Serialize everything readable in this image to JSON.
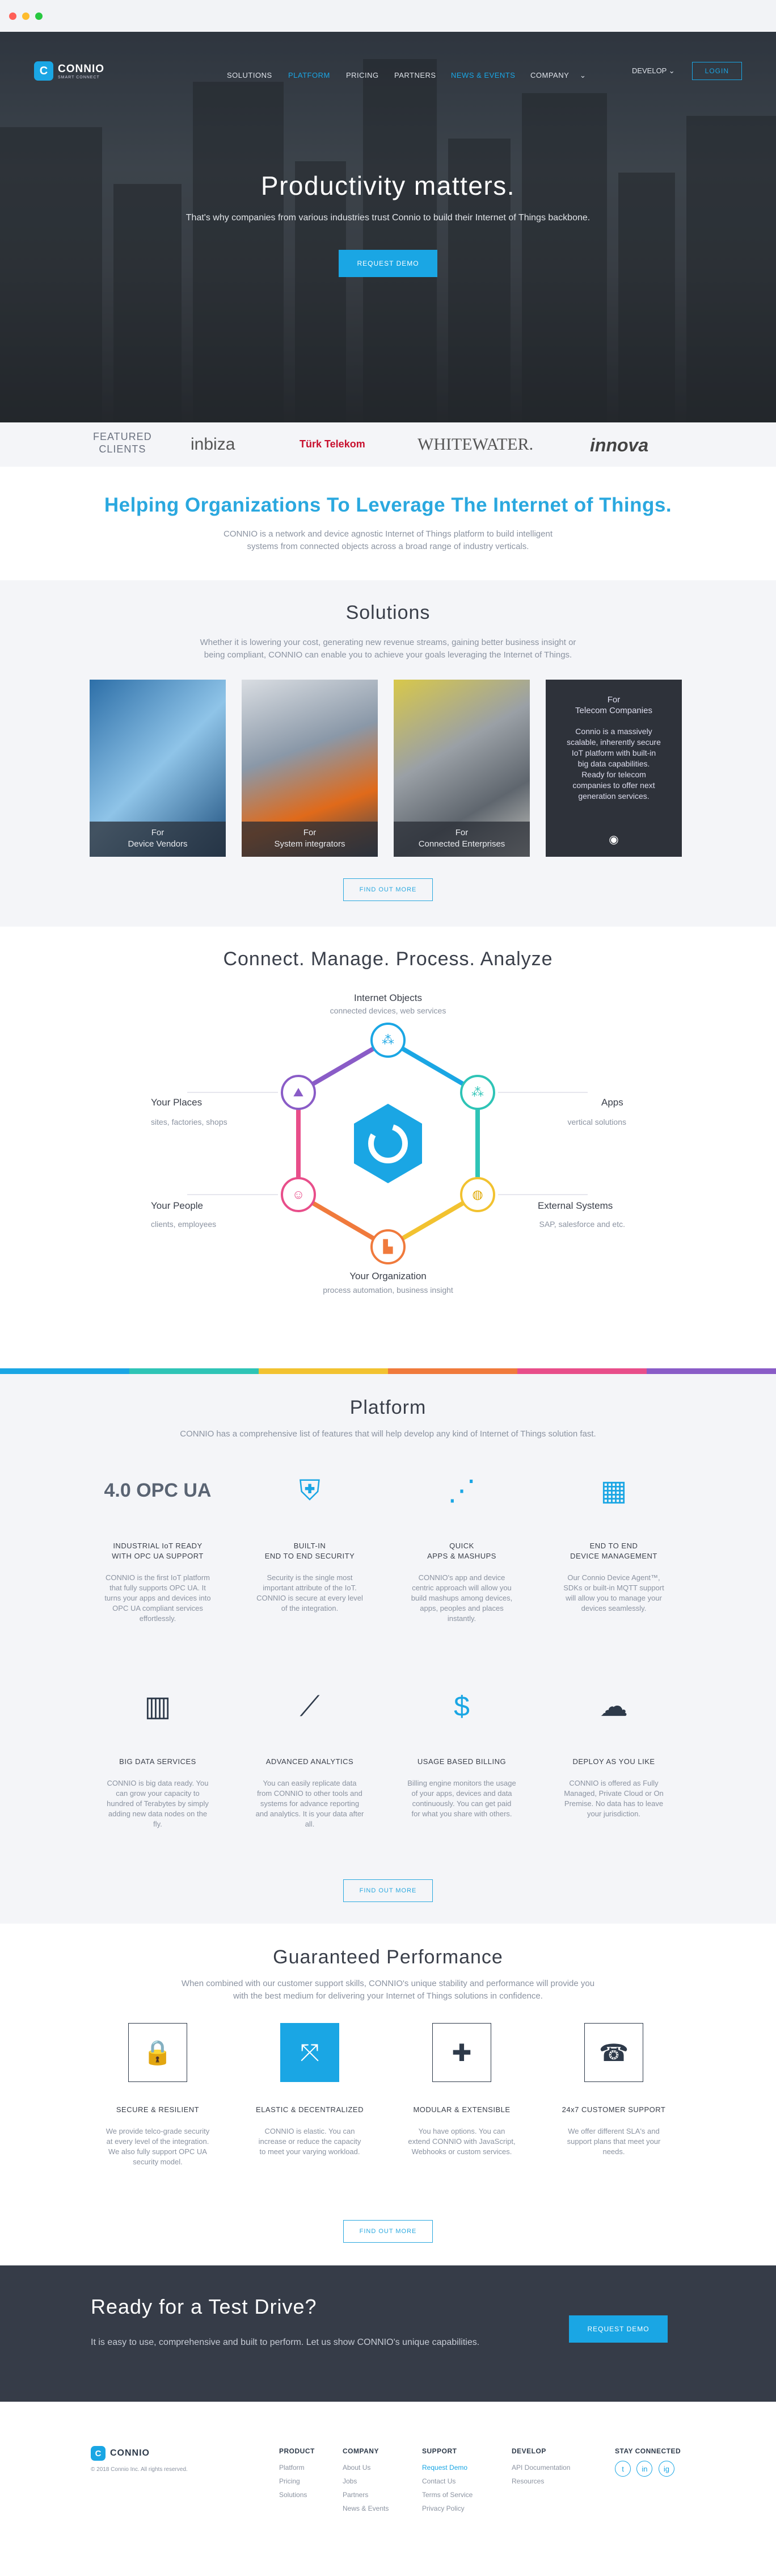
{
  "brand": {
    "name": "CONNIO",
    "tagline": "SMART CONNECT",
    "letter": "C",
    "blue": "#1aa6e4"
  },
  "nav": {
    "items": [
      "SOLUTIONS",
      "PLATFORM",
      "PRICING",
      "PARTNERS",
      "NEWS & EVENTS",
      "COMPANY"
    ],
    "active": "PLATFORM",
    "develop": "DEVELOP",
    "login": "LOGIN"
  },
  "hero": {
    "title": "Productivity matters.",
    "subtitle": "That's why companies from various industries trust Connio to build their Internet of Things backbone.",
    "cta": "REQUEST DEMO"
  },
  "clients": {
    "label_line1": "FEATURED",
    "label_line2": "CLIENTS",
    "logos": [
      "inbiza",
      "Türk Telekom",
      "WHITEWATER.",
      "innova"
    ]
  },
  "helping": {
    "title": "Helping Organizations To Leverage The Internet of Things.",
    "text_line1": "CONNIO is a network and device agnostic Internet of Things platform to build intelligent",
    "text_line2": "systems from connected objects across a broad range of industry verticals."
  },
  "solutions": {
    "title": "Solutions",
    "text_line1": "Whether it is lowering your cost, generating new revenue streams, gaining better business insight or",
    "text_line2": "being compliant, CONNIO can enable you to achieve your goals leveraging the Internet of Things.",
    "cards": [
      {
        "line1": "For",
        "line2": "Device Vendors"
      },
      {
        "line1": "For",
        "line2": "System integrators"
      },
      {
        "line1": "For",
        "line2": "Connected Enterprises"
      }
    ],
    "telecom": {
      "line1": "For",
      "line2": "Telecom Companies",
      "text": "Connio is a massively scalable, inherently secure IoT platform with built-in big data capabilities. Ready for telecom companies to offer next generation services."
    },
    "find_more": "FIND OUT MORE"
  },
  "cmpa": {
    "title": "Connect. Manage. Process. Analyze",
    "nodes": [
      {
        "title": "Internet Objects",
        "sub": "connected devices, web services"
      },
      {
        "title": "Apps",
        "sub": "vertical solutions"
      },
      {
        "title": "External Systems",
        "sub": "SAP, salesforce and etc."
      },
      {
        "title": "Your Organization",
        "sub": "process automation, business insight"
      },
      {
        "title": "Your People",
        "sub": "clients, employees"
      },
      {
        "title": "Your Places",
        "sub": "sites, factories, shops"
      }
    ],
    "colors": [
      "#1aa6e4",
      "#2ec4b6",
      "#f2c230",
      "#f07a3c",
      "#e84e8a",
      "#8a5cc7"
    ]
  },
  "platform": {
    "title": "Platform",
    "text": "CONNIO has a comprehensive list of features that will help develop any kind of Internet of Things solution fast.",
    "features": [
      {
        "t1": "INDUSTRIAL IoT READY",
        "t2": "WITH OPC UA SUPPORT",
        "d": "CONNIO is the first IoT platform that fully supports OPC UA. It turns your apps and devices into OPC UA compliant services effortlessly.",
        "icon": "opc-ua-icon",
        "glyph": "4.0 OPC UA"
      },
      {
        "t1": "BUILT-IN",
        "t2": "END TO END SECURITY",
        "d": "Security is the single most important attribute of the IoT. CONNIO is secure at every level of the integration.",
        "icon": "shield-network-icon",
        "glyph": "⛨"
      },
      {
        "t1": "QUICK",
        "t2": "APPS & MASHUPS",
        "d": "CONNIO's app and device centric approach will allow you build mashups among devices, apps, peoples and places instantly.",
        "icon": "mashup-network-icon",
        "glyph": "⋰"
      },
      {
        "t1": "END TO END",
        "t2": "DEVICE MANAGEMENT",
        "d": "Our Connio Device Agent™, SDKs or built-in MQTT support will allow you to manage your devices seamlessly.",
        "icon": "devices-icon",
        "glyph": "▦"
      },
      {
        "t1": "BIG DATA SERVICES",
        "t2": "",
        "d": "CONNIO is big data ready. You can grow your capacity to hundred of Terabytes by simply adding new data nodes on the fly.",
        "icon": "servers-icon",
        "glyph": "▥"
      },
      {
        "t1": "ADVANCED ANALYTICS",
        "t2": "",
        "d": "You can easily replicate data from CONNIO to other tools and systems for advance reporting and analytics. It is your data after all.",
        "icon": "line-chart-icon",
        "glyph": "⟋"
      },
      {
        "t1": "USAGE BASED BILLING",
        "t2": "",
        "d": "Billing engine monitors the usage of your apps, devices and data continuously. You can get paid for what you share with others.",
        "icon": "billing-icon",
        "glyph": "$"
      },
      {
        "t1": "DEPLOY AS YOU LIKE",
        "t2": "",
        "d": "CONNIO is offered as Fully Managed, Private Cloud or On Premise. No data has to leave your jurisdiction.",
        "icon": "cloud-download-icon",
        "glyph": "☁"
      }
    ],
    "find_more": "FIND OUT MORE"
  },
  "performance": {
    "title": "Guaranteed Performance",
    "text_line1": "When combined with our customer support skills, CONNIO's unique stability and performance will provide you",
    "text_line2": "with the best medium for delivering your Internet of Things solutions in confidence.",
    "items": [
      {
        "t": "SECURE & RESILIENT",
        "d": "We provide telco-grade security at every level of the integration. We also fully support OPC UA security model.",
        "icon": "lock-icon",
        "glyph": "🔒"
      },
      {
        "t": "ELASTIC & DECENTRALIZED",
        "d": "CONNIO is elastic. You can increase or reduce the capacity to meet your varying workload.",
        "icon": "expand-arrows-icon",
        "glyph": "⤧"
      },
      {
        "t": "MODULAR & EXTENSIBLE",
        "d": "You have options. You can extend CONNIO with JavaScript, Webhooks or custom services.",
        "icon": "puzzle-icon",
        "glyph": "✚"
      },
      {
        "t": "24x7 CUSTOMER SUPPORT",
        "d": "We offer different SLA's and support plans that meet your needs.",
        "icon": "phone-clock-icon",
        "glyph": "☎"
      }
    ],
    "find_more": "FIND OUT MORE"
  },
  "cta": {
    "title": "Ready for a Test Drive?",
    "text": "It is easy to use, comprehensive and built to perform. Let us show CONNIO's unique capabilities.",
    "button": "REQUEST DEMO"
  },
  "footer": {
    "copyright": "© 2018 Connio Inc. All rights reserved.",
    "cols": [
      {
        "h": "PRODUCT",
        "links": [
          "Platform",
          "Pricing",
          "Solutions"
        ]
      },
      {
        "h": "COMPANY",
        "links": [
          "About Us",
          "Jobs",
          "Partners",
          "News & Events"
        ]
      },
      {
        "h": "SUPPORT",
        "links": [
          "Request Demo",
          "Contact Us",
          "Terms of Service",
          "Privacy Policy"
        ]
      },
      {
        "h": "DEVELOP",
        "links": [
          "API Documentation",
          "Resources"
        ]
      }
    ],
    "social_title": "STAY CONNECTED",
    "social": [
      "t",
      "in",
      "ig"
    ]
  }
}
